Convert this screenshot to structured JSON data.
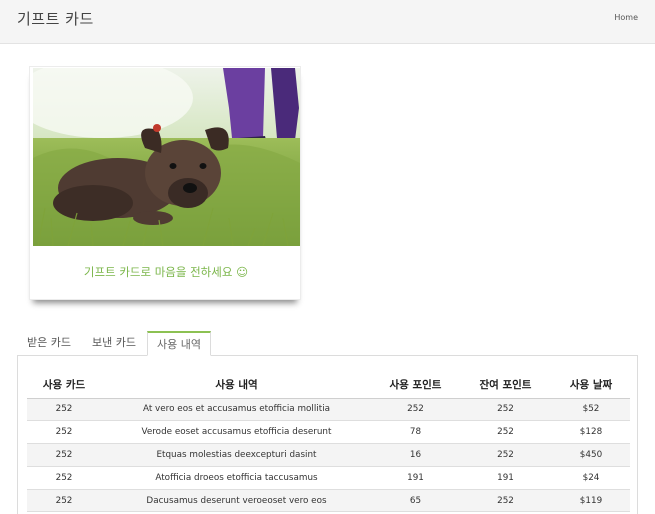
{
  "header": {
    "brand": "기프트 카드",
    "home": "Home"
  },
  "card": {
    "caption": "기프트 카드로 마음을 전하세요 ☺",
    "image": "puppy-in-grass-photo"
  },
  "tabs": [
    {
      "label": "받은 카드",
      "active": false
    },
    {
      "label": "보낸 카드",
      "active": false
    },
    {
      "label": "사용 내역",
      "active": true
    }
  ],
  "table": {
    "headers": [
      "사용 카드",
      "사용 내역",
      "사용 포인트",
      "잔여 포인트",
      "사용 날짜"
    ],
    "rows": [
      [
        "252",
        "At vero eos et accusamus etofficia mollitia",
        "252",
        "252",
        "$52"
      ],
      [
        "252",
        "Verode eoset accusamus etofficia deserunt",
        "78",
        "252",
        "$128"
      ],
      [
        "252",
        "Etquas molestias deexcepturi dasint",
        "16",
        "252",
        "$450"
      ],
      [
        "252",
        "Atofficia droeos etofficia taccusamus",
        "191",
        "191",
        "$24"
      ],
      [
        "252",
        "Dacusamus deserunt veroeoset vero eos",
        "65",
        "252",
        "$119"
      ]
    ]
  },
  "colors": {
    "accent": "#8cc152",
    "caption": "#7bb64a"
  }
}
